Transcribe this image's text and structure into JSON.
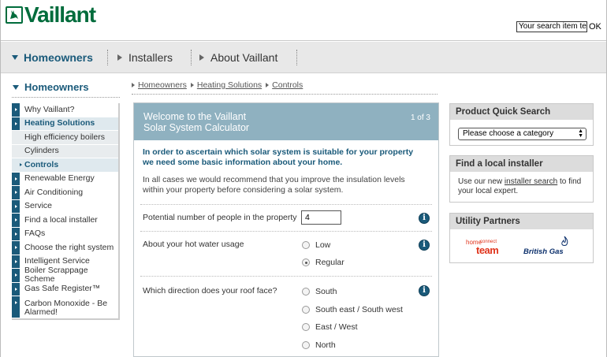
{
  "brand": {
    "name": "Vaillant",
    "color": "#006c3c",
    "icon": "hare-logo-icon"
  },
  "search": {
    "placeholder": "Your search item ter",
    "button": "OK"
  },
  "topnav": {
    "items": [
      {
        "label": "Homeowners",
        "active": true
      },
      {
        "label": "Installers",
        "active": false
      },
      {
        "label": "About Vaillant",
        "active": false
      }
    ]
  },
  "sidebar": {
    "title": "Homeowners",
    "items": [
      {
        "label": "Why Vaillant?"
      },
      {
        "label": "Heating Solutions"
      },
      {
        "label": "High efficiency boilers"
      },
      {
        "label": "Cylinders"
      },
      {
        "label": "Controls"
      },
      {
        "label": "Renewable Energy"
      },
      {
        "label": "Air Conditioning"
      },
      {
        "label": "Service"
      },
      {
        "label": "Find a local installer"
      },
      {
        "label": "FAQs"
      },
      {
        "label": "Choose the right system"
      },
      {
        "label": "Intelligent Service"
      },
      {
        "label": "Boiler Scrappage Scheme"
      },
      {
        "label": "Gas Safe Register™"
      },
      {
        "label": "Carbon Monoxide - Be Alarmed!"
      }
    ]
  },
  "breadcrumb": [
    "Homeowners",
    "Heating Solutions",
    "Controls"
  ],
  "calculator": {
    "title_line1": "Welcome to the Vaillant",
    "title_line2": "Solar System Calculator",
    "step": "1 of 3",
    "intro": "In order to ascertain which solar system is suitable for your property we need some basic information about your home.",
    "note": "In all cases we would recommend that you improve the insulation levels within your property before considering a solar system.",
    "q_people": "Potential number of people in the property",
    "people_value": "4",
    "q_water": "About your hot water usage",
    "water_options": [
      "Low",
      "Regular"
    ],
    "water_selected": "Regular",
    "q_roof": "Which direction does your roof face?",
    "roof_options": [
      "South",
      "South east / South west",
      "East / West",
      "North"
    ],
    "info_glyph": "i"
  },
  "product_search": {
    "title": "Product Quick Search",
    "select_value": "Please choose a category"
  },
  "installer": {
    "title": "Find a local installer",
    "text_before": "Use our new ",
    "link": "installer search",
    "text_after": " to find your local expert."
  },
  "utility": {
    "title": "Utility Partners",
    "partner1_top": "home",
    "partner1_small": "connect",
    "partner1_bottom": "team",
    "partner2": "British Gas"
  },
  "colors": {
    "accent": "#1a5a7a",
    "panel_head": "#8fb1c0",
    "partner_red": "#e0341c",
    "british_gas_blue": "#0b2f6b"
  }
}
